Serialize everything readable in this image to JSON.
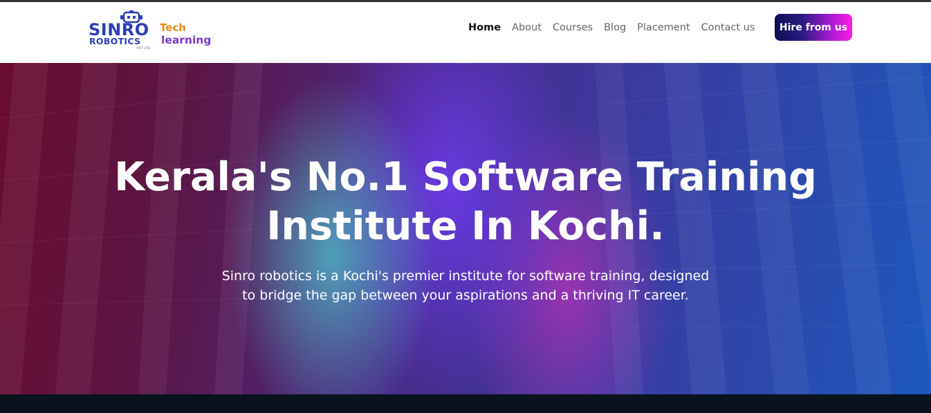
{
  "brand": {
    "name_line1": "SINRO",
    "name_line2": "ROBOTICS",
    "pvt": "PVT LTD",
    "tagline_1": "Tech",
    "tagline_2": "learning"
  },
  "nav": {
    "items": [
      {
        "label": "Home",
        "active": true
      },
      {
        "label": "About",
        "active": false
      },
      {
        "label": "Courses",
        "active": false
      },
      {
        "label": "Blog",
        "active": false
      },
      {
        "label": "Placement",
        "active": false
      },
      {
        "label": "Contact us",
        "active": false
      }
    ],
    "cta_label": "Hire from us"
  },
  "hero": {
    "title_line1": "Kerala's No.1 Software Training",
    "title_line2": "Institute In Kochi.",
    "description_line1": "Sinro robotics is a Kochi's premier institute for software training, designed",
    "description_line2": "to bridge the gap between your aspirations and a thriving IT career."
  },
  "colors": {
    "brand_blue": "#2b3db8",
    "cta_gradient_start": "#0a0f55",
    "cta_gradient_end": "#ff1ce4",
    "footer_band": "#08131e"
  }
}
